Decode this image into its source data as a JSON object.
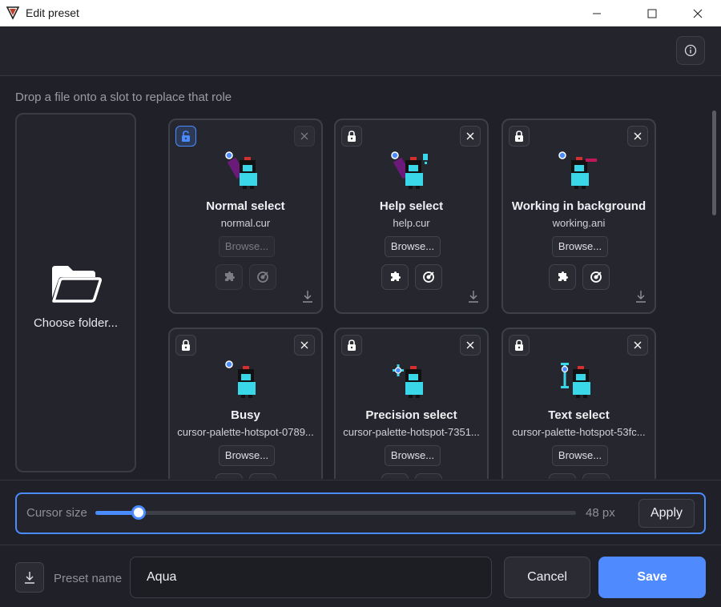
{
  "window": {
    "title": "Edit preset"
  },
  "hint": "Drop a file onto a slot to replace that role",
  "folder": {
    "label": "Choose folder..."
  },
  "slots": [
    {
      "title": "Normal select",
      "file": "normal.cur",
      "browse": "Browse...",
      "locked_active": true,
      "sprite": "arrow"
    },
    {
      "title": "Help select",
      "file": "help.cur",
      "browse": "Browse...",
      "locked_active": false,
      "sprite": "help"
    },
    {
      "title": "Working in background",
      "file": "working.ani",
      "browse": "Browse...",
      "locked_active": false,
      "sprite": "working"
    },
    {
      "title": "Busy",
      "file": "cursor-palette-hotspot-0789...",
      "browse": "Browse...",
      "locked_active": false,
      "sprite": "busy"
    },
    {
      "title": "Precision select",
      "file": "cursor-palette-hotspot-7351...",
      "browse": "Browse...",
      "locked_active": false,
      "sprite": "cross"
    },
    {
      "title": "Text select",
      "file": "cursor-palette-hotspot-53fc...",
      "browse": "Browse...",
      "locked_active": false,
      "sprite": "text"
    }
  ],
  "cursor_size": {
    "label": "Cursor size",
    "value": "48 px",
    "slider_fraction": 0.09,
    "apply": "Apply"
  },
  "preset": {
    "label": "Preset name",
    "value": "Aqua"
  },
  "actions": {
    "cancel": "Cancel",
    "save": "Save"
  },
  "colors": {
    "accent": "#4a8cff",
    "save": "#4f8bff",
    "sprite_body": "#39d7e8"
  }
}
